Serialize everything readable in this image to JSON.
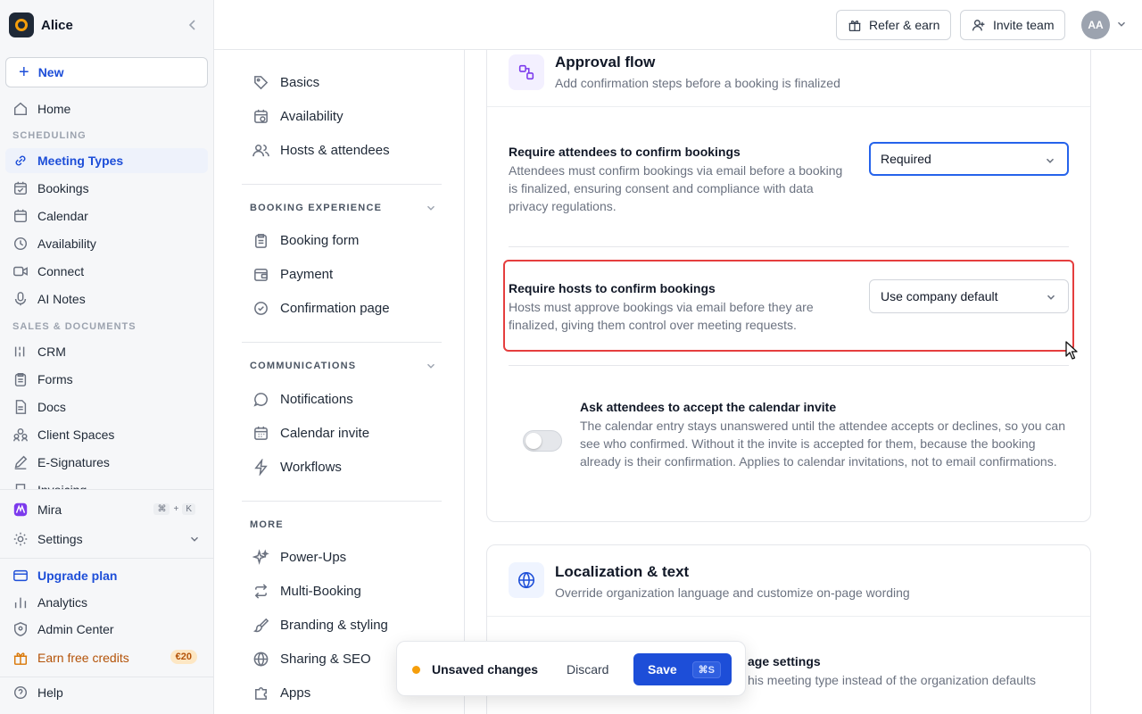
{
  "workspace": {
    "name": "Alice"
  },
  "sidebar": {
    "new_label": "New",
    "items_top": [
      {
        "label": "Home"
      }
    ],
    "section_scheduling": "SCHEDULING",
    "scheduling": [
      {
        "label": "Meeting Types"
      },
      {
        "label": "Bookings"
      },
      {
        "label": "Calendar"
      },
      {
        "label": "Availability"
      },
      {
        "label": "Connect"
      },
      {
        "label": "AI Notes"
      }
    ],
    "section_sales": "SALES & DOCUMENTS",
    "sales": [
      {
        "label": "CRM"
      },
      {
        "label": "Forms"
      },
      {
        "label": "Docs"
      },
      {
        "label": "Client Spaces"
      },
      {
        "label": "E-Signatures"
      },
      {
        "label": "Invoicing"
      }
    ],
    "mira": {
      "label": "Mira",
      "shortcut": [
        "⌘",
        "+",
        "K"
      ]
    },
    "settings_label": "Settings",
    "upgrade_label": "Upgrade plan",
    "analytics_label": "Analytics",
    "admin_label": "Admin Center",
    "earn_label": "Earn free credits",
    "earn_badge": "€20",
    "help_label": "Help"
  },
  "topbar": {
    "refer_label": "Refer & earn",
    "invite_label": "Invite team",
    "avatar_initials": "AA"
  },
  "settings_nav": {
    "top": [
      {
        "label": "Basics"
      },
      {
        "label": "Availability"
      },
      {
        "label": "Hosts & attendees"
      }
    ],
    "section_booking": "BOOKING EXPERIENCE",
    "booking": [
      {
        "label": "Booking form"
      },
      {
        "label": "Payment"
      },
      {
        "label": "Confirmation page"
      }
    ],
    "section_comms": "COMMUNICATIONS",
    "comms": [
      {
        "label": "Notifications"
      },
      {
        "label": "Calendar invite"
      },
      {
        "label": "Workflows"
      }
    ],
    "section_more": "MORE",
    "more": [
      {
        "label": "Power-Ups"
      },
      {
        "label": "Multi-Booking"
      },
      {
        "label": "Branding & styling"
      },
      {
        "label": "Sharing & SEO"
      },
      {
        "label": "Apps"
      }
    ]
  },
  "approval": {
    "title": "Approval flow",
    "subtitle": "Add confirmation steps before a booking is finalized",
    "attendees_title": "Require attendees to confirm bookings",
    "attendees_desc": "Attendees must confirm bookings via email before a booking is finalized, ensuring consent and compliance with data privacy regulations.",
    "attendees_value": "Required",
    "hosts_title": "Require hosts to confirm bookings",
    "hosts_desc": "Hosts must approve bookings via email before they are finalized, giving them control over meeting requests.",
    "hosts_value": "Use company default",
    "invite_title": "Ask attendees to accept the calendar invite",
    "invite_desc": "The calendar entry stays unanswered until the attendee accepts or declines, so you can see who confirmed. Without it the invite is accepted for them, because the booking already is their confirmation. Applies to calendar invitations, not to email confirmations.",
    "invite_enabled": false
  },
  "localization": {
    "title": "Localization & text",
    "subtitle": "Override organization language and customize on-page wording",
    "row_title_visible": "age settings",
    "row_desc_visible": "his meeting type instead of the organization defaults"
  },
  "unsaved": {
    "label": "Unsaved changes",
    "discard": "Discard",
    "save": "Save",
    "save_shortcut": "⌘S"
  },
  "colors": {
    "accent": "#1d4ed8",
    "highlight": "#e53e3e",
    "warning_dot": "#f59e0b"
  }
}
